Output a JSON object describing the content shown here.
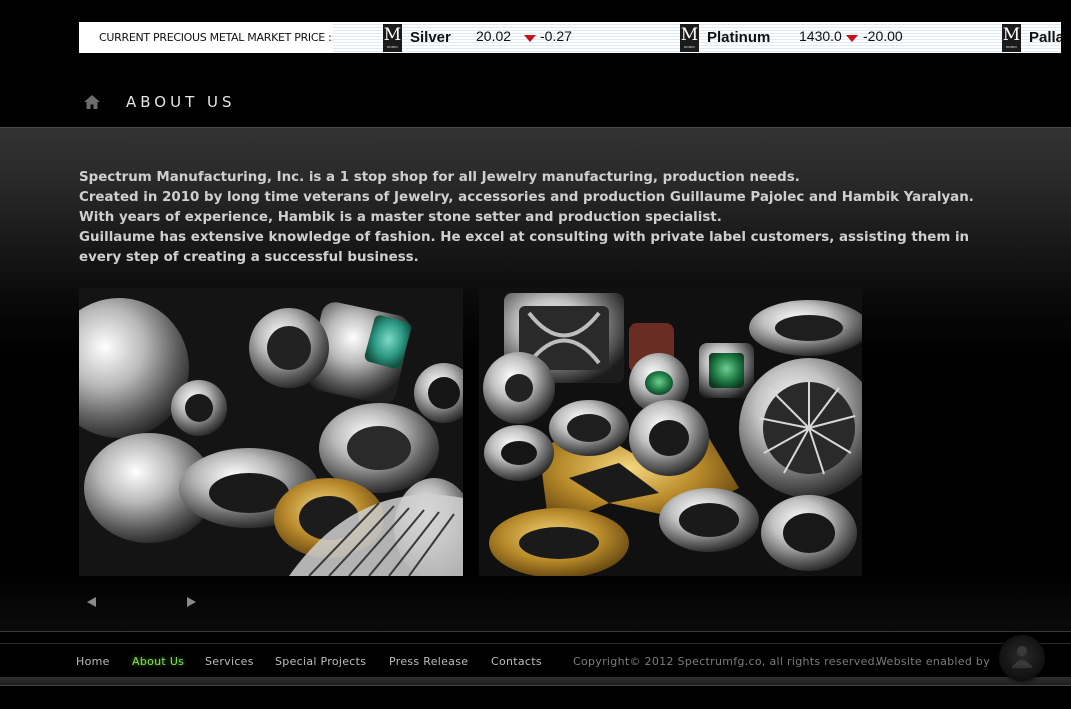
{
  "ticker": {
    "label": "CURRENT PRECIOUS METAL MARKET PRICE ::",
    "logo_letter": "M",
    "logo_sub": "MONEX",
    "metals": [
      {
        "name": "Silver",
        "price": "20.02",
        "change": "-0.27",
        "direction": "down"
      },
      {
        "name": "Platinum",
        "price": "1430.0",
        "change": "-20.00",
        "direction": "down"
      },
      {
        "name": "Palla",
        "price": "",
        "change": "",
        "direction": ""
      }
    ],
    "down_color": "#c4121a"
  },
  "header": {
    "title": "ABOUT US",
    "home_icon": "home-icon"
  },
  "intro": {
    "lines": [
      "Spectrum Manufacturing, Inc. is a 1 stop shop for all Jewelry manufacturing, production needs.",
      "Created in 2010 by long time veterans of Jewelry, accessories and production Guillaume Pajolec and Hambik Yaralyan.",
      "With years of experience, Hambik is a master stone setter and production specialist.",
      "Guillaume has extensive knowledge of fashion. He excel at consulting with private label customers, assisting them in every step of creating a successful business."
    ]
  },
  "gallery": {
    "photos": [
      {
        "subject": "pile of silver and gold rings with turquoise stone"
      },
      {
        "subject": "silver and gold rings and bracelets on display"
      }
    ],
    "prev_icon": "triangle-left-icon",
    "next_icon": "triangle-right-icon"
  },
  "footer": {
    "nav": [
      {
        "label": "Home",
        "active": false
      },
      {
        "label": "About Us",
        "active": true
      },
      {
        "label": "Services",
        "active": false
      },
      {
        "label": "Special Projects",
        "active": false
      },
      {
        "label": "Press Release",
        "active": false
      },
      {
        "label": "Contacts",
        "active": false
      }
    ],
    "copyright": "Copyright© 2012 Spectrumfg.co, all rights reserved.",
    "enabled_by": "Website enabled by",
    "active_color": "#8bdc55"
  }
}
